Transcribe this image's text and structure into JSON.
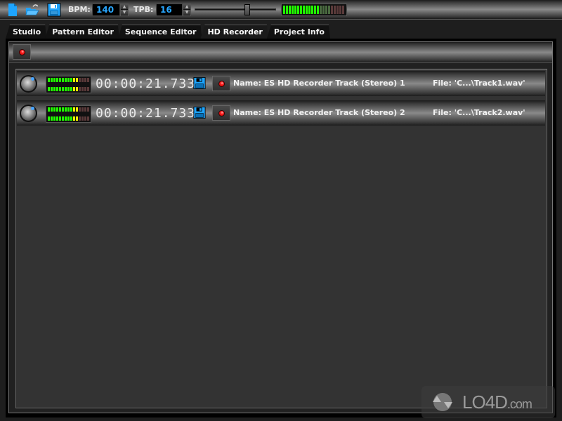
{
  "toolbar": {
    "icons": [
      "new-file-icon",
      "open-folder-icon",
      "save-icon"
    ],
    "bpm_label": "BPM:",
    "bpm_value": "140",
    "tpb_label": "TPB:",
    "tpb_value": "16",
    "tempo_slider_position": 0.66,
    "master_meter": {
      "left_level": 0.6,
      "right_level": 0.6
    }
  },
  "tabs": [
    {
      "label": "Studio",
      "active": false
    },
    {
      "label": "Pattern Editor",
      "active": false
    },
    {
      "label": "Sequence Editor",
      "active": false
    },
    {
      "label": "HD Recorder",
      "active": true
    },
    {
      "label": "Project Info",
      "active": false
    }
  ],
  "recorder": {
    "record_all_button": "record-icon",
    "tracks": [
      {
        "time": "00:00:21.733",
        "name": "Name: ES HD Recorder Track (Stereo) 1",
        "file": "File: 'C...\\Track1.wav'",
        "meter_level": 0.75
      },
      {
        "time": "00:00:21.733",
        "name": "Name: ES HD Recorder Track (Stereo) 2",
        "file": "File: 'C...\\Track2.wav'",
        "meter_level": 0.75
      }
    ]
  },
  "colors": {
    "accent_blue": "#29a7ff",
    "record_red": "#ff2020",
    "meter_green": "#22ff00",
    "meter_yellow": "#ffff00",
    "meter_off": "#5a3a3a"
  },
  "watermark": {
    "text": "LO4D",
    "suffix": ".com"
  }
}
